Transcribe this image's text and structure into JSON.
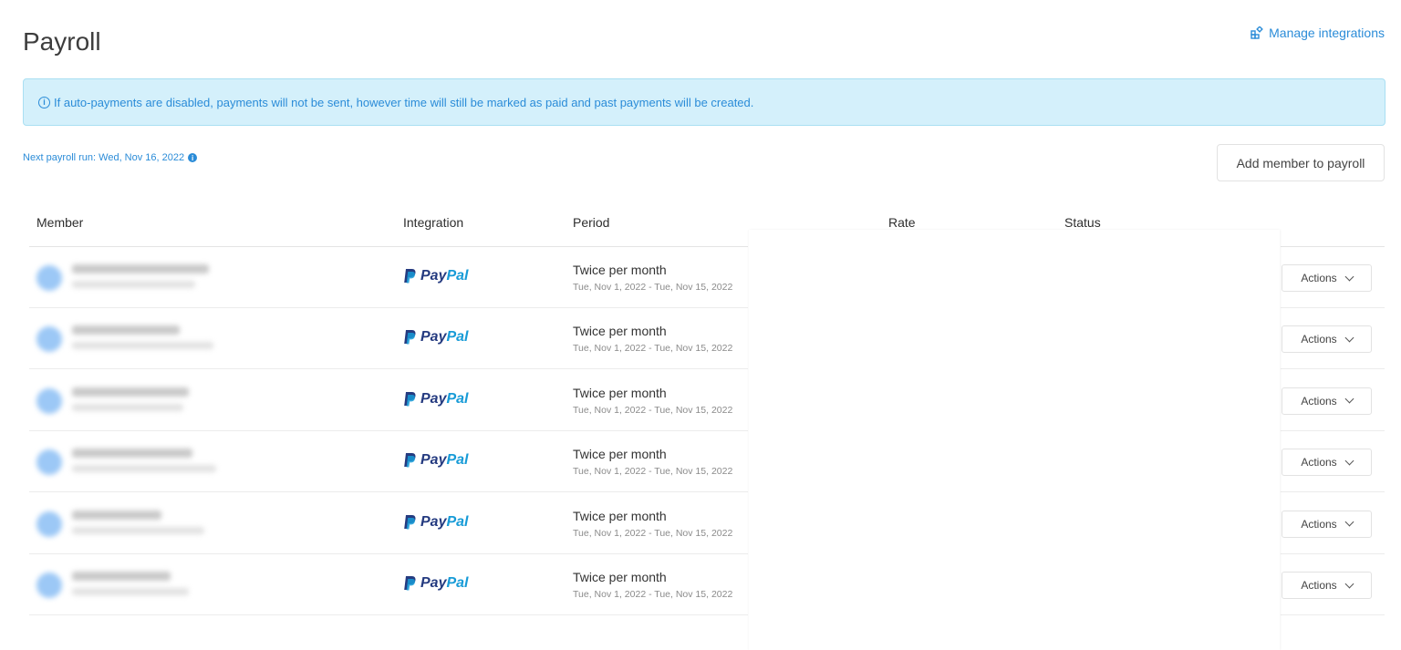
{
  "page": {
    "title": "Payroll",
    "manage_integrations": "Manage integrations"
  },
  "banner": {
    "text": "If auto-payments are disabled, payments will not be sent, however time will still be marked as paid and past payments will be created.",
    "icon": "info-circle-icon"
  },
  "next_run": {
    "text": "Next payroll run: Wed, Nov 16, 2022"
  },
  "add_member_label": "Add member to payroll",
  "columns": [
    "Member",
    "Integration",
    "Period",
    "Rate",
    "Status"
  ],
  "rows": [
    {
      "integration_pay": "Pay",
      "integration_pal": "Pal",
      "period": "Twice per month",
      "dates": "Tue, Nov 1, 2022 - Tue, Nov 15, 2022",
      "actions": "Actions"
    },
    {
      "integration_pay": "Pay",
      "integration_pal": "Pal",
      "period": "Twice per month",
      "dates": "Tue, Nov 1, 2022 - Tue, Nov 15, 2022",
      "actions": "Actions"
    },
    {
      "integration_pay": "Pay",
      "integration_pal": "Pal",
      "period": "Twice per month",
      "dates": "Tue, Nov 1, 2022 - Tue, Nov 15, 2022",
      "actions": "Actions"
    },
    {
      "integration_pay": "Pay",
      "integration_pal": "Pal",
      "period": "Twice per month",
      "dates": "Tue, Nov 1, 2022 - Tue, Nov 15, 2022",
      "actions": "Actions"
    },
    {
      "integration_pay": "Pay",
      "integration_pal": "Pal",
      "period": "Twice per month",
      "dates": "Tue, Nov 1, 2022 - Tue, Nov 15, 2022",
      "actions": "Actions"
    },
    {
      "integration_pay": "Pay",
      "integration_pal": "Pal",
      "period": "Twice per month",
      "dates": "Tue, Nov 1, 2022 - Tue, Nov 15, 2022",
      "actions": "Actions"
    }
  ],
  "colors": {
    "accent": "#2b8cd8",
    "banner_bg": "#d4f0fb",
    "paypal_dark": "#253b80",
    "paypal_light": "#179bd7"
  }
}
